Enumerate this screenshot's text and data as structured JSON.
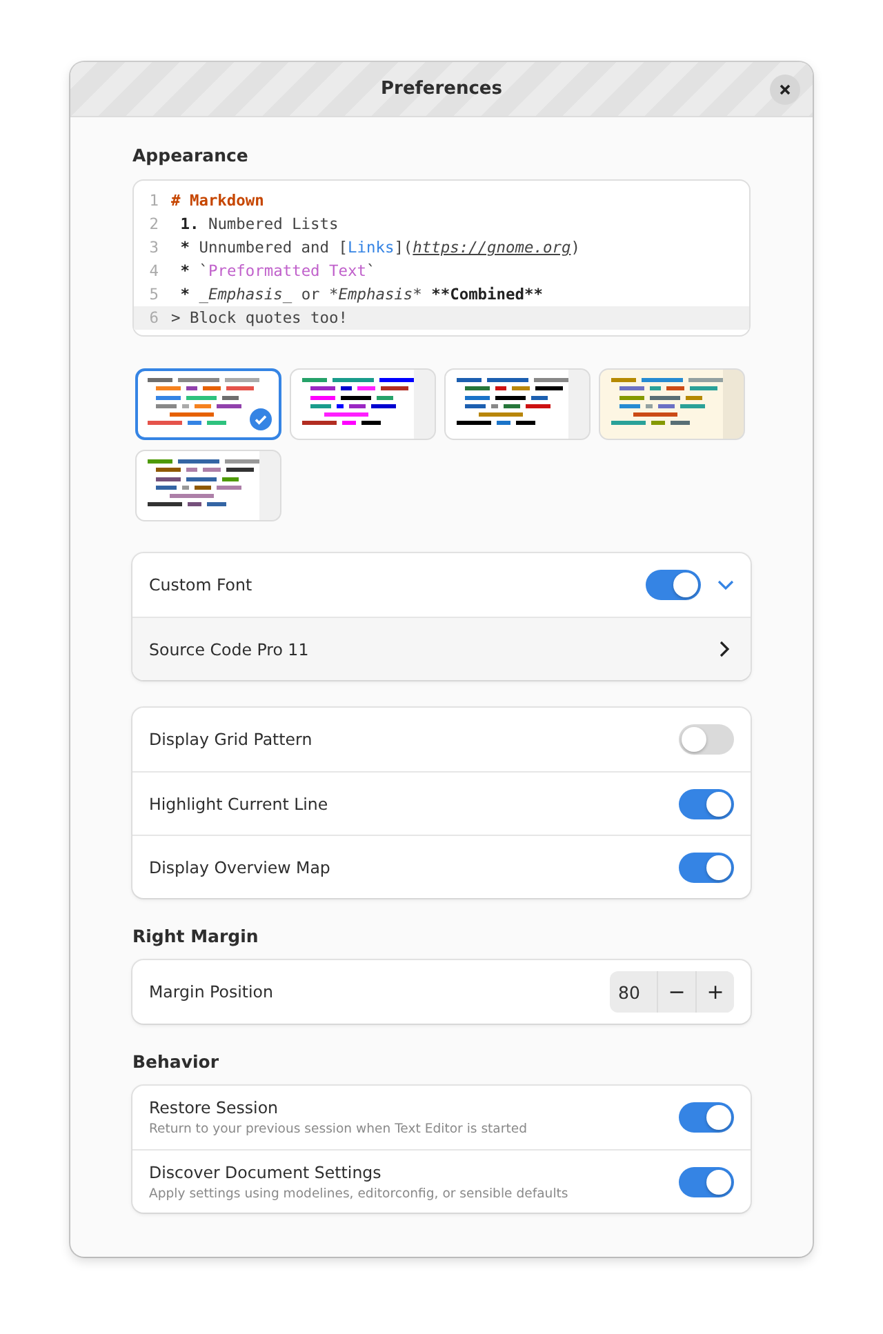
{
  "window": {
    "title": "Preferences"
  },
  "appearance": {
    "heading": "Appearance",
    "code_lines": [
      {
        "number": "1",
        "current": false,
        "segments": [
          {
            "text": "# Markdown",
            "kind": "heading"
          }
        ]
      },
      {
        "number": "2",
        "current": false,
        "segments": [
          {
            "text": " 1.",
            "kind": "bold"
          },
          {
            "text": " Numbered Lists",
            "kind": "plain"
          }
        ]
      },
      {
        "number": "3",
        "current": false,
        "segments": [
          {
            "text": " *",
            "kind": "bold"
          },
          {
            "text": " Unnumbered and [",
            "kind": "plain"
          },
          {
            "text": "Links",
            "kind": "link"
          },
          {
            "text": "](",
            "kind": "plain"
          },
          {
            "text": "https://gnome.org",
            "kind": "url"
          },
          {
            "text": ")",
            "kind": "plain"
          }
        ]
      },
      {
        "number": "4",
        "current": false,
        "segments": [
          {
            "text": " *",
            "kind": "bold"
          },
          {
            "text": " `",
            "kind": "plain"
          },
          {
            "text": "Preformatted Text",
            "kind": "code"
          },
          {
            "text": "`",
            "kind": "plain"
          }
        ]
      },
      {
        "number": "5",
        "current": false,
        "segments": [
          {
            "text": " *",
            "kind": "bold"
          },
          {
            "text": " _Emphasis_",
            "kind": "emphasis"
          },
          {
            "text": " or ",
            "kind": "plain"
          },
          {
            "text": "*Emphasis*",
            "kind": "emphasis"
          },
          {
            "text": " **Combined**",
            "kind": "bold"
          }
        ]
      },
      {
        "number": "6",
        "current": true,
        "segments": [
          {
            "text": "> Block quotes too!",
            "kind": "plain"
          }
        ]
      }
    ],
    "schemes": [
      {
        "selected": true,
        "color": "#ffffff"
      },
      {
        "selected": false,
        "color": "#ffffff"
      },
      {
        "selected": false,
        "color": "#ffffff"
      },
      {
        "selected": false,
        "color": "#fdf6e3"
      },
      {
        "selected": false,
        "color": "#ffffff"
      }
    ],
    "font": {
      "label": "Custom Font",
      "on": true,
      "expanded": true,
      "value": "Source Code Pro 11"
    },
    "toggles": [
      {
        "label": "Display Grid Pattern",
        "on": false
      },
      {
        "label": "Highlight Current Line",
        "on": true
      },
      {
        "label": "Display Overview Map",
        "on": true
      }
    ]
  },
  "right_margin": {
    "heading": "Right Margin",
    "label": "Margin Position",
    "value": "80",
    "decrease": "−",
    "increase": "+"
  },
  "behavior": {
    "heading": "Behavior",
    "rows": [
      {
        "label": "Restore Session",
        "subtitle": "Return to your previous session when Text Editor is started",
        "on": true
      },
      {
        "label": "Discover Document Settings",
        "subtitle": "Apply settings using modelines, editorconfig, or sensible defaults",
        "on": true
      }
    ]
  }
}
